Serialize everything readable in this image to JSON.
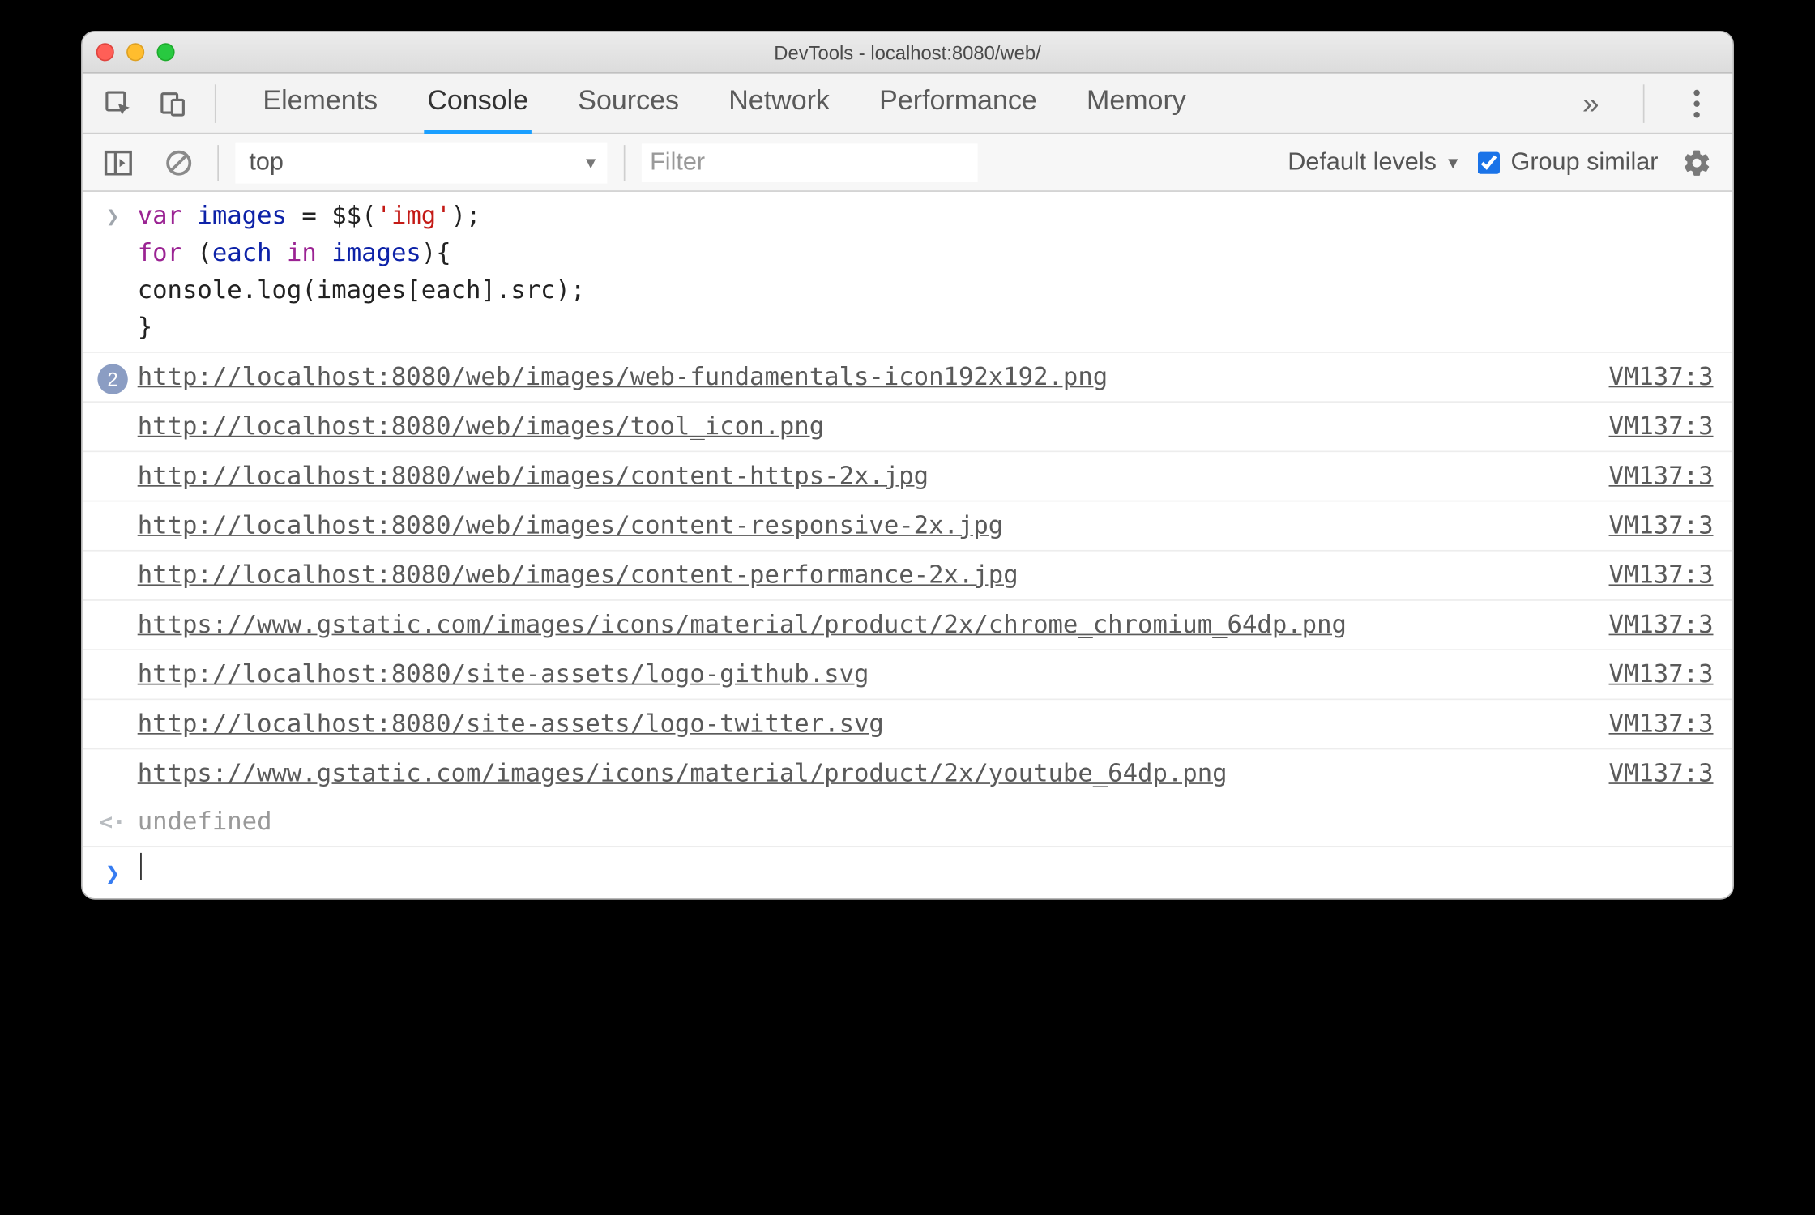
{
  "window": {
    "title": "DevTools - localhost:8080/web/"
  },
  "tabs": {
    "items": [
      "Elements",
      "Console",
      "Sources",
      "Network",
      "Performance",
      "Memory"
    ],
    "active_index": 1,
    "overflow_glyph": "»"
  },
  "toolbar": {
    "context": "top",
    "filter_placeholder": "Filter",
    "levels_label": "Default levels",
    "group_similar_label": "Group similar",
    "group_similar_checked": true
  },
  "code": {
    "line1_kw_var": "var",
    "line1_ident": "images",
    "line1_rest_a": " = $$(",
    "line1_str": "'img'",
    "line1_rest_b": ");",
    "line2_kw_for": "for",
    "line2_paren_open": " (",
    "line2_ident_each": "each",
    "line2_kw_in": " in ",
    "line2_ident_images": "images",
    "line2_paren_close": "){",
    "line3": "    console.log(images[each].src);",
    "line4": "}"
  },
  "logs": [
    {
      "count": 2,
      "url": "http://localhost:8080/web/images/web-fundamentals-icon192x192.png",
      "src": "VM137:3"
    },
    {
      "url": "http://localhost:8080/web/images/tool_icon.png",
      "src": "VM137:3"
    },
    {
      "url": "http://localhost:8080/web/images/content-https-2x.jpg",
      "src": "VM137:3"
    },
    {
      "url": "http://localhost:8080/web/images/content-responsive-2x.jpg",
      "src": "VM137:3"
    },
    {
      "url": "http://localhost:8080/web/images/content-performance-2x.jpg",
      "src": "VM137:3"
    },
    {
      "url": "https://www.gstatic.com/images/icons/material/product/2x/chrome_chromium_64dp.png",
      "src": "VM137:3"
    },
    {
      "url": "http://localhost:8080/site-assets/logo-github.svg",
      "src": "VM137:3"
    },
    {
      "url": "http://localhost:8080/site-assets/logo-twitter.svg",
      "src": "VM137:3"
    },
    {
      "url": "https://www.gstatic.com/images/icons/material/product/2x/youtube_64dp.png",
      "src": "VM137:3"
    }
  ],
  "return_value": "undefined"
}
